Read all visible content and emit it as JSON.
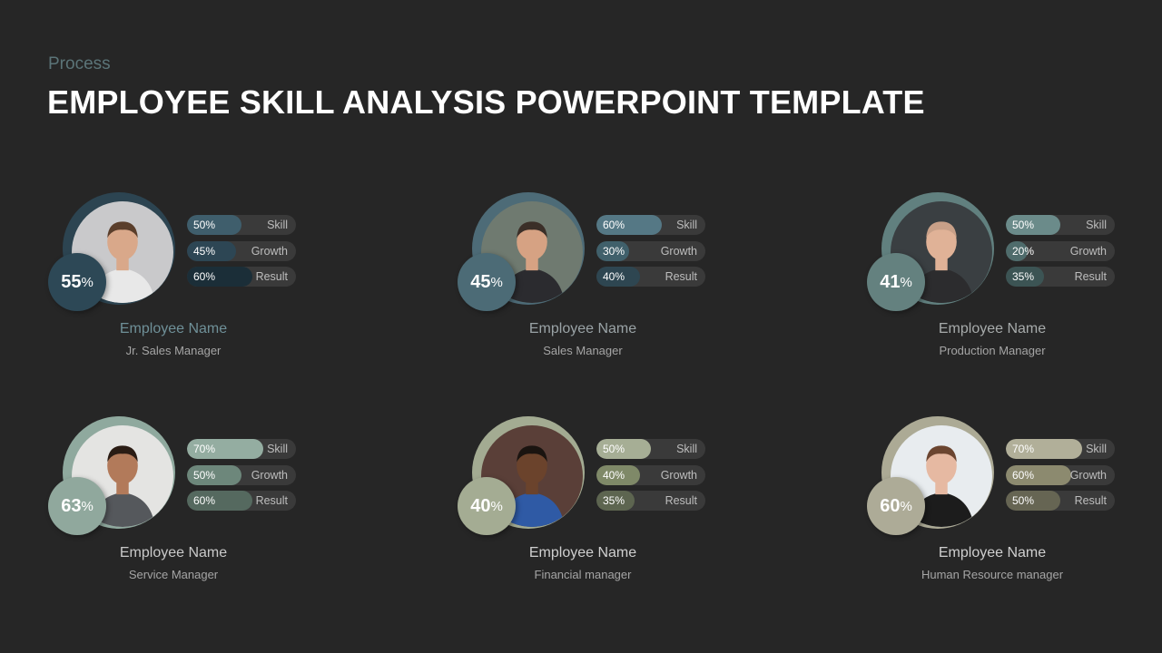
{
  "header": {
    "subtitle": "Process",
    "title": "EMPLOYEE SKILL ANALYSIS POWERPOINT TEMPLATE"
  },
  "employees": [
    {
      "name": "Employee Name",
      "role": "Jr. Sales Manager",
      "score": "55",
      "score_suffix": "%",
      "photo": "man-with-glasses-portrait",
      "colors": {
        "ring": "#2c4451",
        "badge": "#2d4856",
        "name": "#6f9098",
        "skill": "#3f5e6c",
        "growth": "#2d4654",
        "result": "#1b2e38"
      },
      "metrics": [
        {
          "label": "Skill",
          "value": "50%",
          "fraction": 0.5
        },
        {
          "label": "Growth",
          "value": "45%",
          "fraction": 0.45
        },
        {
          "label": "Result",
          "value": "60%",
          "fraction": 0.6
        }
      ]
    },
    {
      "name": "Employee Name",
      "role": "Sales Manager",
      "score": "45",
      "score_suffix": "%",
      "photo": "businessman-with-phone",
      "colors": {
        "ring": "#4d6b77",
        "badge": "#4c6b76",
        "name": "#9aa3a6",
        "skill": "#557885",
        "growth": "#40606b",
        "result": "#2e4651"
      },
      "metrics": [
        {
          "label": "Skill",
          "value": "60%",
          "fraction": 0.6
        },
        {
          "label": "Growth",
          "value": "30%",
          "fraction": 0.3
        },
        {
          "label": "Result",
          "value": "40%",
          "fraction": 0.4
        }
      ]
    },
    {
      "name": "Employee Name",
      "role": "Production Manager",
      "score": "41",
      "score_suffix": "%",
      "photo": "presenter-gesturing",
      "colors": {
        "ring": "#61807f",
        "badge": "#64817f",
        "name": "#a7abab",
        "skill": "#6b8b8a",
        "growth": "#4f6c6c",
        "result": "#3c5454"
      },
      "metrics": [
        {
          "label": "Skill",
          "value": "50%",
          "fraction": 0.5
        },
        {
          "label": "Growth",
          "value": "20%",
          "fraction": 0.2
        },
        {
          "label": "Result",
          "value": "35%",
          "fraction": 0.35
        }
      ]
    },
    {
      "name": "Employee Name",
      "role": "Service Manager",
      "score": "63",
      "score_suffix": "%",
      "photo": "smiling-man-in-office",
      "colors": {
        "ring": "#8fa99e",
        "badge": "#90a89d",
        "name": "#c9c9c9",
        "skill": "#94ad a1",
        "growth": "#6d877b",
        "result": "#55695f"
      },
      "metrics": [
        {
          "label": "Skill",
          "value": "70%",
          "fraction": 0.7
        },
        {
          "label": "Growth",
          "value": "50%",
          "fraction": 0.5
        },
        {
          "label": "Result",
          "value": "60%",
          "fraction": 0.6
        }
      ]
    },
    {
      "name": "Employee Name",
      "role": "Financial manager",
      "score": "40",
      "score_suffix": "%",
      "photo": "man-in-blue-suit",
      "colors": {
        "ring": "#a3ab92",
        "badge": "#a4ac93",
        "name": "#cfcfcf",
        "skill": "#a6ae95",
        "growth": "#7f8968",
        "result": "#5d6550"
      },
      "metrics": [
        {
          "label": "Skill",
          "value": "50%",
          "fraction": 0.5
        },
        {
          "label": "Growth",
          "value": "40%",
          "fraction": 0.4
        },
        {
          "label": "Result",
          "value": "35%",
          "fraction": 0.35
        }
      ]
    },
    {
      "name": "Employee Name",
      "role": "Human Resource manager",
      "score": "60",
      "score_suffix": "%",
      "photo": "woman-portrait",
      "colors": {
        "ring": "#acaa95",
        "badge": "#adab97",
        "name": "#cfcfcf",
        "skill": "#b1af99",
        "growth": "#8c8a6f",
        "result": "#666553"
      },
      "metrics": [
        {
          "label": "Skill",
          "value": "70%",
          "fraction": 0.7
        },
        {
          "label": "Growth",
          "value": "60%",
          "fraction": 0.6
        },
        {
          "label": "Result",
          "value": "50%",
          "fraction": 0.5
        }
      ]
    }
  ]
}
